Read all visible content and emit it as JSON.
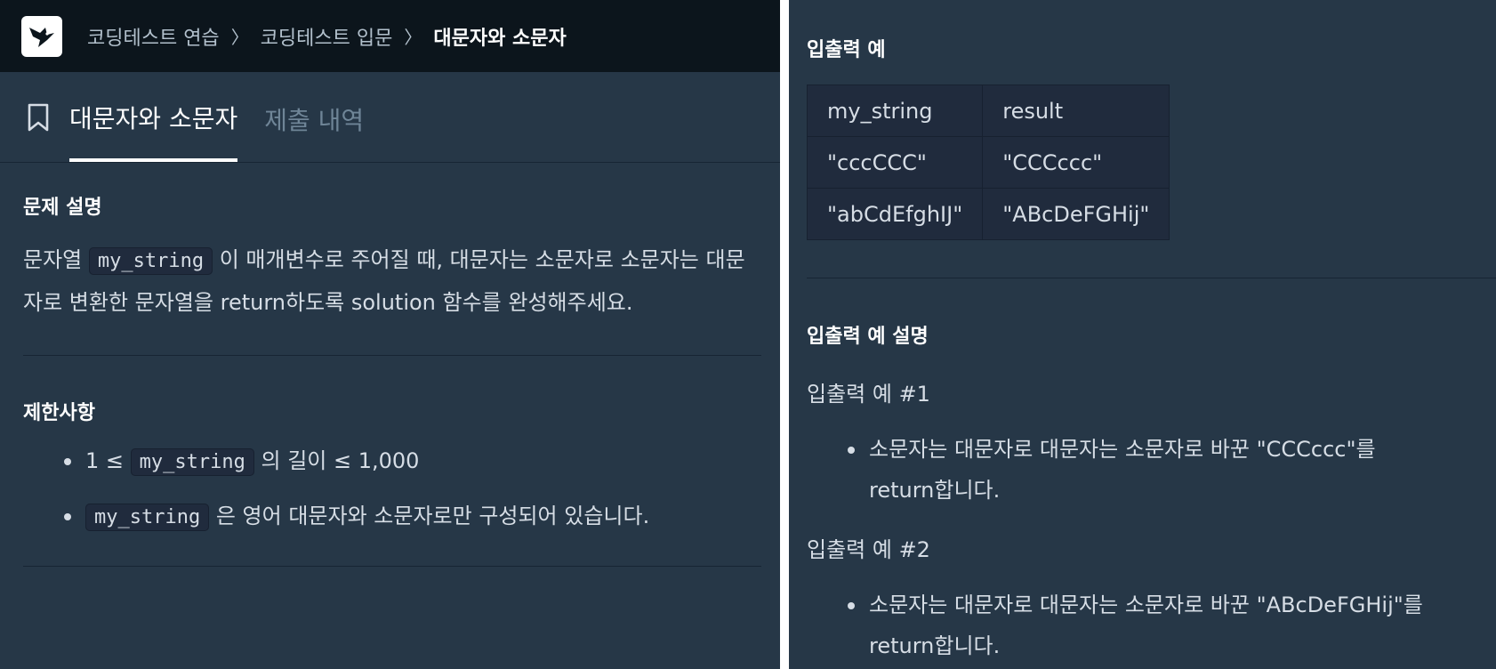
{
  "breadcrumb": [
    "코딩테스트 연습",
    "코딩테스트 입문",
    "대문자와 소문자"
  ],
  "tabs": {
    "active": "대문자와 소문자",
    "submissions": "제출 내역"
  },
  "description": {
    "title": "문제 설명",
    "text_1": "문자열 ",
    "code": "my_string",
    "text_2": " 이 매개변수로 주어질 때, 대문자는 소문자로 소문자는 대문자로 변환한 문자열을 return하도록 solution 함수를 완성해주세요."
  },
  "constraints": {
    "title": "제한사항",
    "items": [
      {
        "pre": "1 ≤ ",
        "code": "my_string",
        "post": " 의 길이 ≤ 1,000"
      },
      {
        "pre": "",
        "code": "my_string",
        "post": " 은 영어 대문자와 소문자로만 구성되어 있습니다."
      }
    ]
  },
  "io_example": {
    "title": "입출력 예",
    "headers": [
      "my_string",
      "result"
    ],
    "rows": [
      [
        "\"cccCCC\"",
        "\"CCCccc\""
      ],
      [
        "\"abCdEfghIJ\"",
        "\"ABcDeFGHij\""
      ]
    ]
  },
  "io_explanation": {
    "title": "입출력 예 설명",
    "examples": [
      {
        "label": "입출력 예 #1",
        "bullet": "소문자는 대문자로 대문자는 소문자로 바꾼 \"CCCccc\"를 return합니다."
      },
      {
        "label": "입출력 예 #2",
        "bullet": "소문자는 대문자로 대문자는 소문자로 바꾼 \"ABcDeFGHij\"를 return합니다."
      }
    ]
  },
  "colors": {
    "panel_bg": "#263747",
    "topbar_bg": "#0c151c",
    "text": "#d6dde5",
    "muted_tab": "#6f8597"
  }
}
